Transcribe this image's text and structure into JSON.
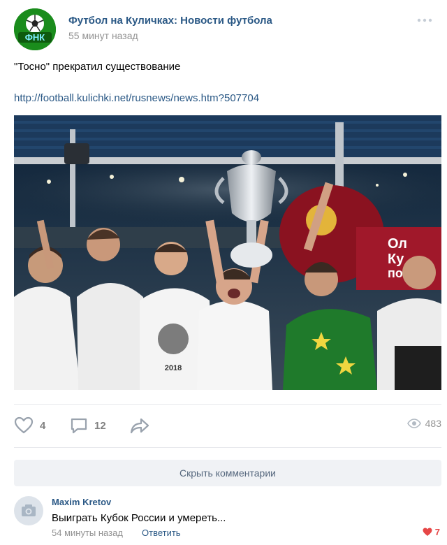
{
  "post": {
    "group_name": "Футбол на Куличках: Новости футбола",
    "time": "55 минут назад",
    "avatar_text": "ФНК",
    "text": "\"Тосно\" прекратил существование",
    "link": "http://football.kulichki.net/rusnews/news.htm?507704",
    "photo": {
      "banner_text": [
        "Ол",
        "Ку",
        "по"
      ],
      "shirt_text": "2018"
    }
  },
  "actions": {
    "likes": "4",
    "comments": "12",
    "views": "483"
  },
  "comments": {
    "hide_label": "Скрыть комментарии",
    "items": [
      {
        "author": "Maxim Kretov",
        "text": "Выиграть Кубок России и умереть...",
        "time": "54 минуты назад",
        "reply_label": "Ответить",
        "likes": "7"
      }
    ]
  },
  "colors": {
    "link": "#2a5885",
    "secondary": "#939393",
    "icon": "#99a2ad",
    "like_active": "#e64646",
    "button_bg": "#f0f2f5"
  }
}
